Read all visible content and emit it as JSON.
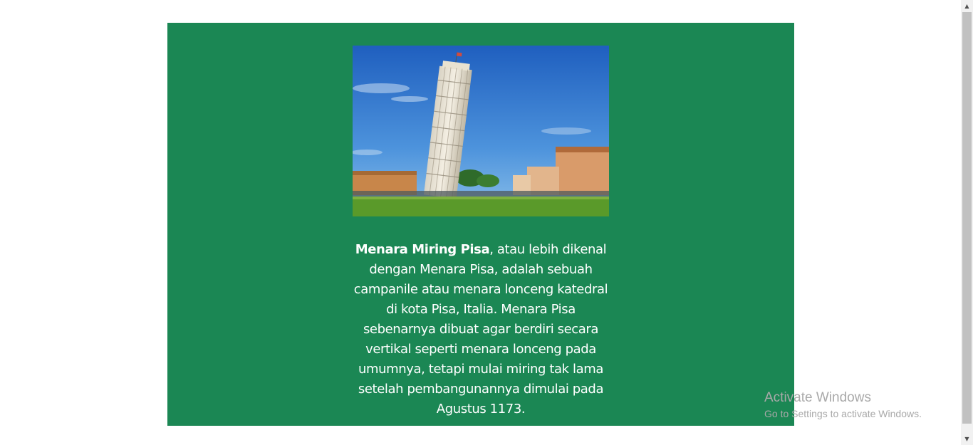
{
  "article": {
    "image_alt": "Menara Miring Pisa",
    "title_bold": "Menara Miring Pisa",
    "body": ", atau lebih dikenal dengan Menara Pisa, adalah sebuah campanile atau menara lonceng katedral di kota Pisa, Italia. Menara Pisa sebenarnya dibuat agar berdiri secara vertikal seperti menara lonceng pada umumnya, tetapi mulai miring tak lama setelah pembangunannya dimulai pada Agustus 1173."
  },
  "watermark": {
    "title": "Activate Windows",
    "subtitle": "Go to Settings to activate Windows."
  },
  "colors": {
    "card": "#1b8754",
    "text": "#ffffff"
  },
  "icons": {
    "scroll_up": "scroll-up-arrow-icon",
    "scroll_down": "scroll-down-arrow-icon"
  }
}
